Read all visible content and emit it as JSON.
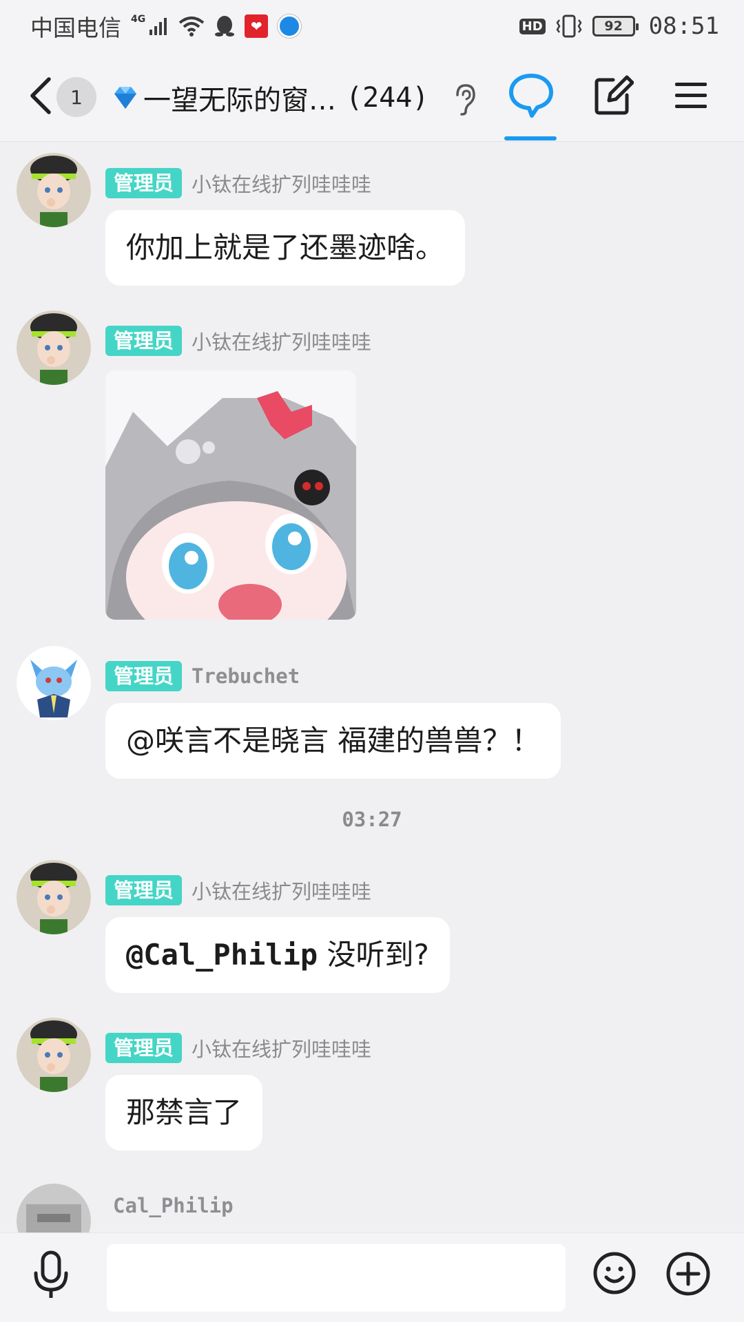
{
  "status_bar": {
    "carrier": "中国电信",
    "network": "4G",
    "hd": "HD",
    "battery": "92",
    "time": "08:51"
  },
  "header": {
    "unread_count": "1",
    "group_name": "一望无际的窗…",
    "member_count": "(244)"
  },
  "messages": [
    {
      "role": "管理员",
      "sender": "小钛在线扩列哇哇哇",
      "text": "你加上就是了还墨迹啥。"
    },
    {
      "role": "管理员",
      "sender": "小钛在线扩列哇哇哇",
      "type": "sticker"
    },
    {
      "role": "管理员",
      "sender": "Trebuchet",
      "text": "@咲言不是晓言  福建的兽兽？！"
    },
    {
      "role": "管理员",
      "sender": "小钛在线扩列哇哇哇",
      "mention": "@Cal_Philip",
      "text": " 没听到?"
    },
    {
      "role": "管理员",
      "sender": "小钛在线扩列哇哇哇",
      "text": "那禁言了"
    },
    {
      "sender": "Cal_Philip"
    }
  ],
  "timestamp": "03:27",
  "input": {
    "value": "",
    "placeholder": ""
  },
  "colors": {
    "accent": "#1a9bf0",
    "admin_badge": "#45d5c6",
    "background": "#f0f0f2"
  }
}
